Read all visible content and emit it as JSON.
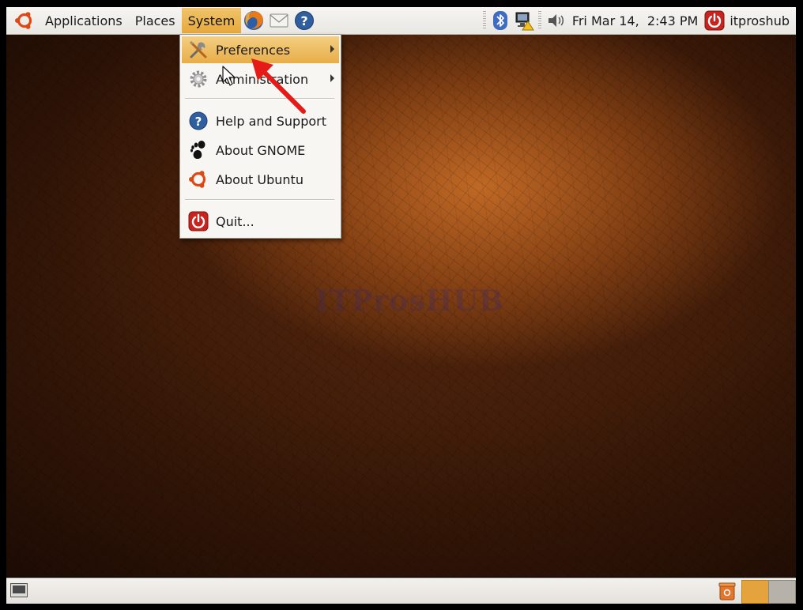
{
  "top_panel": {
    "menus": {
      "applications": "Applications",
      "places": "Places",
      "system": "System"
    },
    "launchers": [
      "firefox-icon",
      "mail-icon",
      "help-icon"
    ],
    "tray": [
      "bluetooth-icon",
      "network-icon",
      "volume-icon"
    ],
    "clock": "Fri Mar 14,  2:43 PM",
    "user": "itproshub"
  },
  "system_menu": {
    "items": [
      {
        "label": "Preferences",
        "icon": "preferences-icon",
        "submenu": true
      },
      {
        "label": "Administration",
        "icon": "administration-icon",
        "submenu": true
      },
      {
        "label": "Help and Support",
        "icon": "help-icon"
      },
      {
        "label": "About GNOME",
        "icon": "gnome-foot-icon"
      },
      {
        "label": "About Ubuntu",
        "icon": "ubuntu-logo-icon"
      },
      {
        "label": "Quit...",
        "icon": "quit-icon"
      }
    ]
  },
  "desktop": {
    "watermark": "ITProsHUB"
  },
  "colors": {
    "highlight": "#e8ad48",
    "ubuntu_orange": "#dd4814",
    "annotation_arrow": "#e41b17"
  }
}
